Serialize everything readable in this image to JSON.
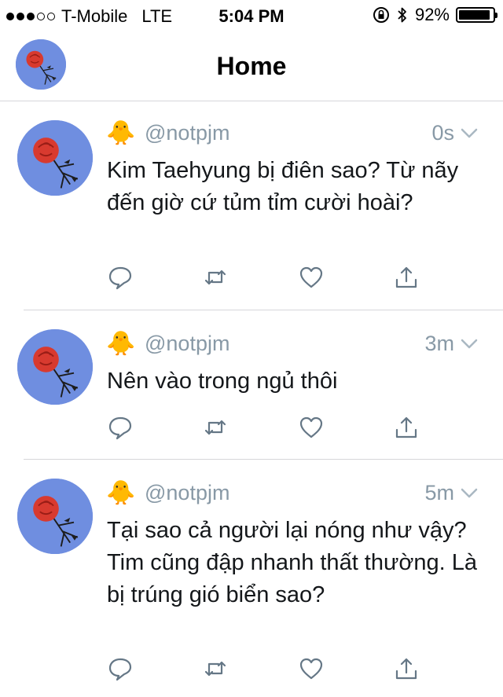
{
  "status_bar": {
    "signal_strength": "3 of 5",
    "carrier": "T-Mobile",
    "network": "LTE",
    "time": "5:04 PM",
    "battery_percent": "92%",
    "battery_level": 0.92,
    "icons": [
      "orientation-lock-icon",
      "bluetooth-icon",
      "battery-icon"
    ]
  },
  "nav": {
    "title": "Home"
  },
  "tweets": [
    {
      "handle": "@notpjm",
      "name_emoji": "🐥",
      "time": "0s",
      "text": "Kim Taehyung bị điên sao? Từ nãy đến giờ cứ tủm tỉm cười hoài?"
    },
    {
      "handle": "@notpjm",
      "name_emoji": "🐥",
      "time": "3m",
      "text": "Nên vào trong ngủ thôi"
    },
    {
      "handle": "@notpjm",
      "name_emoji": "🐥",
      "time": "5m",
      "text": "Tại sao cả người lại nóng như vậy? Tim cũng đập nhanh thất thường. Là bị trúng gió biển sao?"
    }
  ],
  "colors": {
    "secondary_text": "#8899a6",
    "icon": "#657786",
    "divider": "#d6d6da",
    "avatar_bg": "#6f8ee0"
  }
}
